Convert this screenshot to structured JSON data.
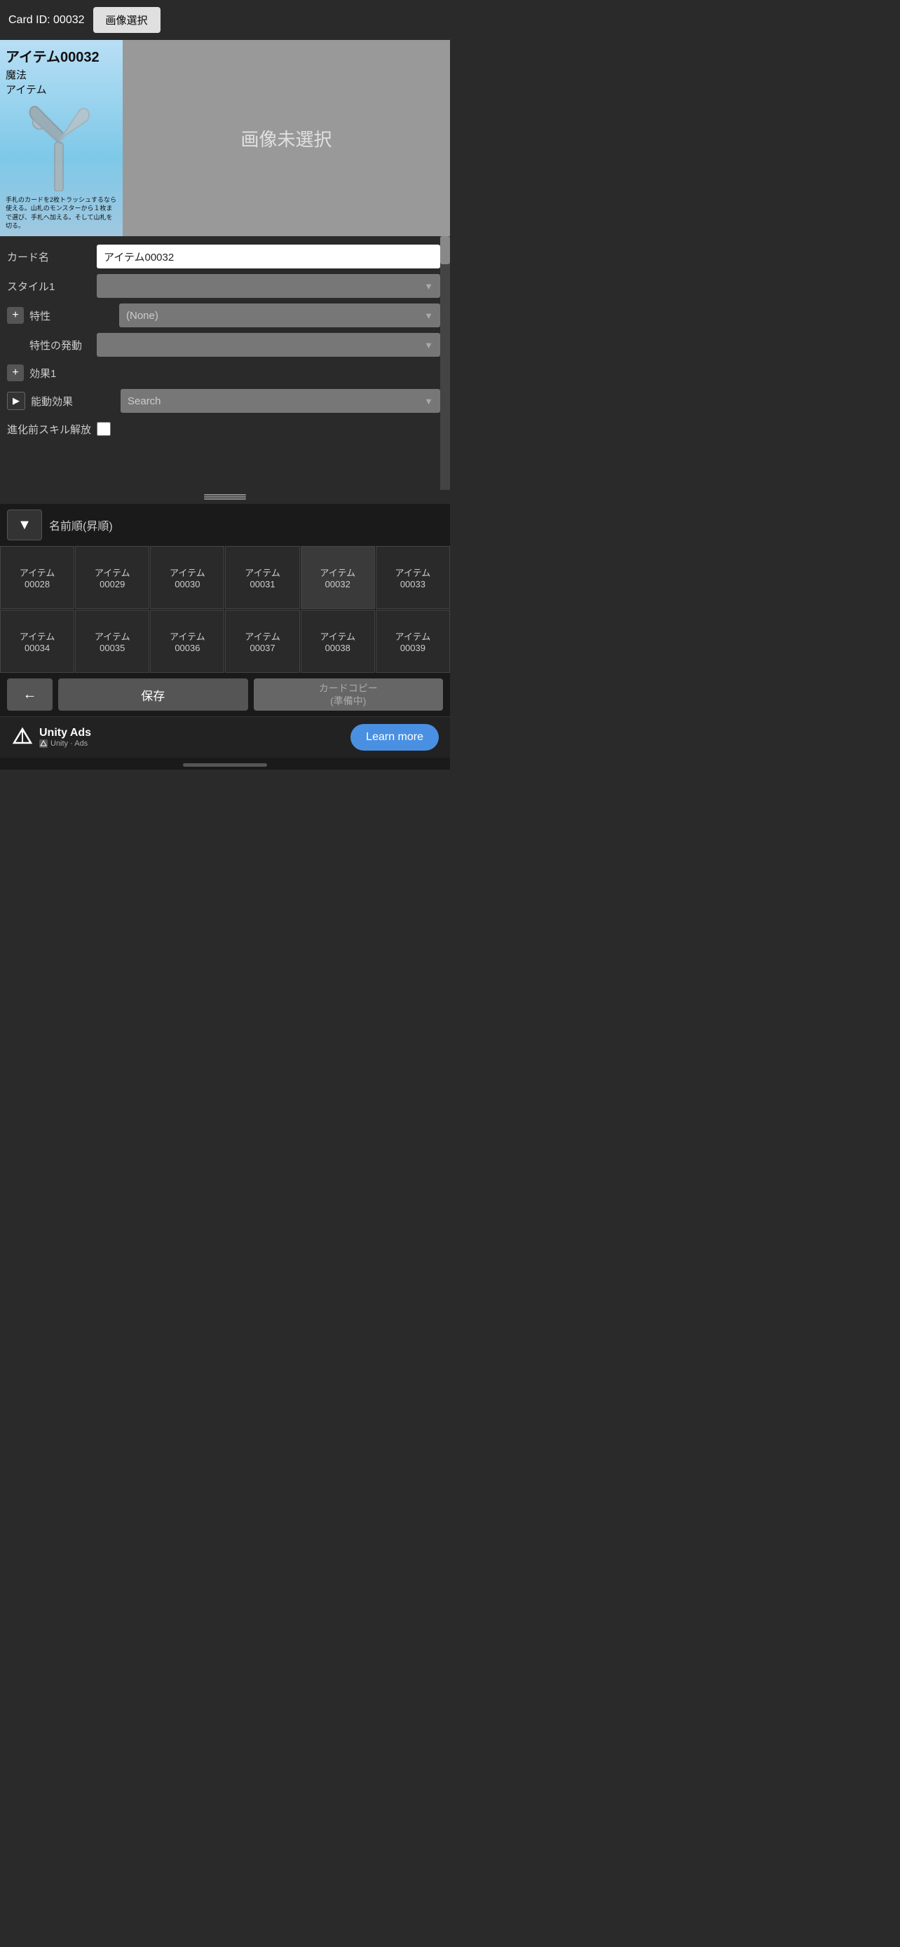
{
  "header": {
    "card_id_label": "Card ID: 00032",
    "image_select_btn": "画像選択"
  },
  "card_preview": {
    "title": "アイテム00032",
    "type1": "魔法",
    "type2": "アイテム",
    "description": "手札のカードを2枚トラッシュするなら使える。山札のモンスターから１枚まで選び、手札へ加える。そして山札を切る。"
  },
  "no_image_panel": {
    "text": "画像未選択"
  },
  "form": {
    "card_name_label": "カード名",
    "card_name_value": "アイテム00032",
    "style1_label": "スタイル1",
    "style1_value": "",
    "trait_label": "特性",
    "trait_value": "(None)",
    "trait_trigger_label": "特性の発動",
    "trait_trigger_value": "",
    "effect1_label": "効果1",
    "effect1_value": "",
    "active_effect_label": "能動効果",
    "active_effect_placeholder": "Search",
    "pre_evo_skill_label": "進化前スキル解放",
    "pre_evo_checked": false
  },
  "sort": {
    "btn_label": "▼",
    "label": "名前順(昇順)"
  },
  "grid_items": [
    {
      "id": "00028",
      "label": "アイテム\n00028"
    },
    {
      "id": "00029",
      "label": "アイテム\n00029"
    },
    {
      "id": "00030",
      "label": "アイテム\n00030"
    },
    {
      "id": "00031",
      "label": "アイテム\n00031"
    },
    {
      "id": "00032",
      "label": "アイテム\n00032"
    },
    {
      "id": "00033",
      "label": "アイテム\n00033"
    },
    {
      "id": "00034",
      "label": "アイテム\n00034"
    },
    {
      "id": "00035",
      "label": "アイテム\n00035"
    },
    {
      "id": "00036",
      "label": "アイテム\n00036"
    },
    {
      "id": "00037",
      "label": "アイテム\n00037"
    },
    {
      "id": "00038",
      "label": "アイテム\n00038"
    },
    {
      "id": "00039",
      "label": "アイテム\n00039"
    }
  ],
  "actions": {
    "back_btn": "←",
    "save_btn": "保存",
    "copy_btn_line1": "カードコピー",
    "copy_btn_line2": "(準備中)"
  },
  "ad": {
    "brand": "Unity Ads",
    "sub": "Unity · Ads",
    "learn_more": "Learn more"
  }
}
